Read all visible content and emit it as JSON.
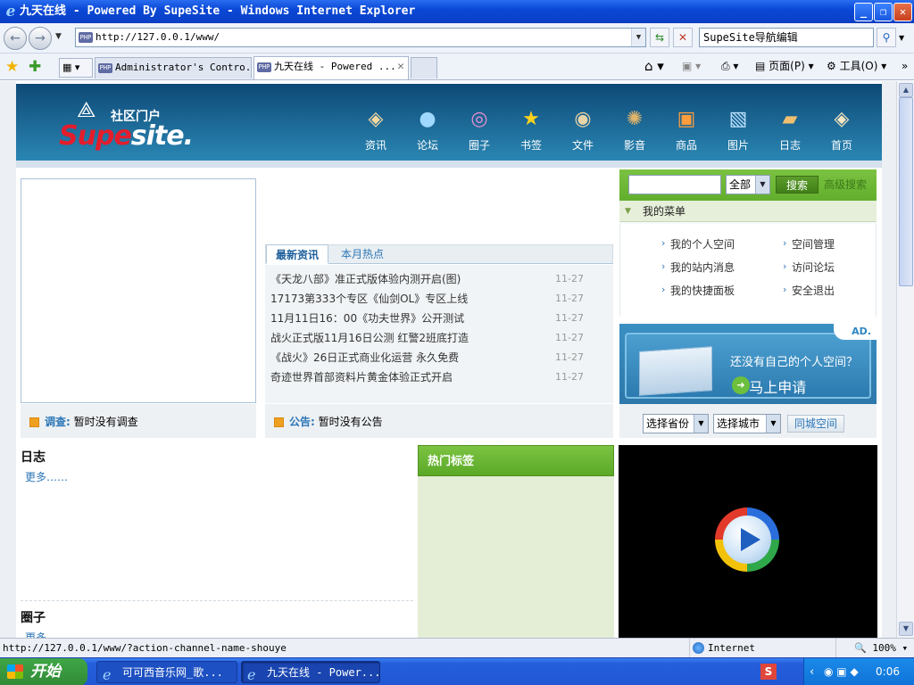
{
  "window": {
    "title": "九天在线 - Powered By SupeSite - Windows Internet Explorer"
  },
  "browser": {
    "address": "http://127.0.0.1/www/",
    "search_value": "SupeSite导航编辑",
    "tabs": [
      {
        "label": "Administrator's Contro..."
      },
      {
        "label": "九天在线 - Powered ..."
      }
    ],
    "cmd": {
      "page": "页面(P)",
      "tools": "工具(O)"
    }
  },
  "site": {
    "logo": {
      "cn": "社区门户",
      "en_a": "Supe",
      "en_b": "site."
    },
    "nav": [
      {
        "label": "资讯",
        "icon": "news-icon"
      },
      {
        "label": "论坛",
        "icon": "forum-icon"
      },
      {
        "label": "圈子",
        "icon": "circle-icon"
      },
      {
        "label": "书签",
        "icon": "bookmark-icon"
      },
      {
        "label": "文件",
        "icon": "file-icon"
      },
      {
        "label": "影音",
        "icon": "media-icon"
      },
      {
        "label": "商品",
        "icon": "goods-icon"
      },
      {
        "label": "图片",
        "icon": "picture-icon"
      },
      {
        "label": "日志",
        "icon": "blog-icon"
      },
      {
        "label": "首页",
        "icon": "home-icon"
      }
    ],
    "news": {
      "tab_active": "最新资讯",
      "tab_other": "本月热点",
      "items": [
        {
          "title": "《天龙八部》准正式版体验内测开启(图)",
          "date": "11-27"
        },
        {
          "title": "17173第333个专区《仙剑OL》专区上线",
          "date": "11-27"
        },
        {
          "title": "11月11日16：00《功夫世界》公开测试",
          "date": "11-27"
        },
        {
          "title": "战火正式版11月16日公测 红警2班底打造",
          "date": "11-27"
        },
        {
          "title": "《战火》26日正式商业化运营 永久免费",
          "date": "11-27"
        },
        {
          "title": "奇迹世界首部资料片黄金体验正式开启",
          "date": "11-27"
        }
      ]
    },
    "search": {
      "scope": "全部",
      "button": "搜索",
      "advanced": "高级搜索"
    },
    "menu": {
      "title": "我的菜单",
      "links": [
        "我的个人空间",
        "空间管理",
        "我的站内消息",
        "访问论坛",
        "我的快捷面板",
        "安全退出"
      ]
    },
    "ad": {
      "tag": "AD.",
      "question": "还没有自己的个人空间？",
      "cta": "马上申请"
    },
    "survey": {
      "label": "调查:",
      "text": "暂时没有调查"
    },
    "notice": {
      "label": "公告:",
      "text": "暂时没有公告"
    },
    "city": {
      "province": "选择省份",
      "city": "选择城市",
      "button": "同城空间"
    },
    "blog": {
      "title": "日志",
      "more": "更多……"
    },
    "group": {
      "title": "圈子",
      "more": "更多……"
    },
    "hottags": {
      "title": "热门标签"
    }
  },
  "status": {
    "url": "http://127.0.0.1/www/?action-channel-name-shouye",
    "zone": "Internet",
    "zoom": "100%"
  },
  "taskbar": {
    "start": "开始",
    "tasks": [
      "可可西音乐网_歌...",
      "九天在线 - Power..."
    ],
    "clock": "0:06"
  }
}
